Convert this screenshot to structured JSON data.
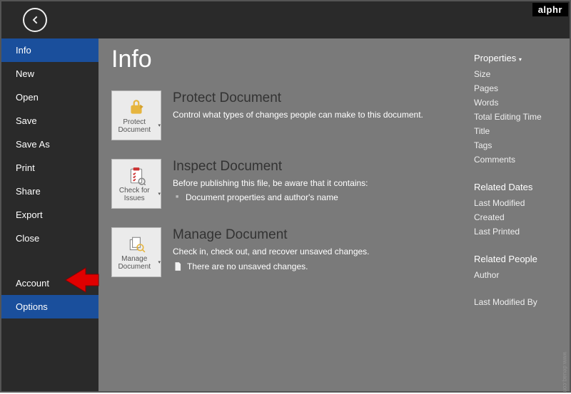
{
  "brand": "alphr",
  "pageTitle": "Info",
  "sidebar": {
    "items": [
      {
        "label": "Info",
        "active": true
      },
      {
        "label": "New"
      },
      {
        "label": "Open"
      },
      {
        "label": "Save"
      },
      {
        "label": "Save As"
      },
      {
        "label": "Print"
      },
      {
        "label": "Share"
      },
      {
        "label": "Export"
      },
      {
        "label": "Close"
      }
    ],
    "bottomItems": [
      {
        "label": "Account"
      },
      {
        "label": "Options",
        "active": true
      }
    ]
  },
  "sections": {
    "protect": {
      "tile": "Protect Document",
      "title": "Protect Document",
      "desc": "Control what types of changes people can make to this document."
    },
    "inspect": {
      "tile": "Check for Issues",
      "title": "Inspect Document",
      "desc": "Before publishing this file, be aware that it contains:",
      "item1": "Document properties and author's name"
    },
    "manage": {
      "tile": "Manage Document",
      "title": "Manage Document",
      "desc": "Check in, check out, and recover unsaved changes.",
      "status": "There are no unsaved changes."
    }
  },
  "properties": {
    "heading": "Properties",
    "basic": [
      "Size",
      "Pages",
      "Words",
      "Total Editing Time",
      "Title",
      "Tags",
      "Comments"
    ],
    "datesHeading": "Related Dates",
    "dates": [
      "Last Modified",
      "Created",
      "Last Printed"
    ],
    "peopleHeading": "Related People",
    "people": [
      "Author"
    ],
    "lastMod": "Last Modified By"
  },
  "watermark": "www.deuaq.com"
}
